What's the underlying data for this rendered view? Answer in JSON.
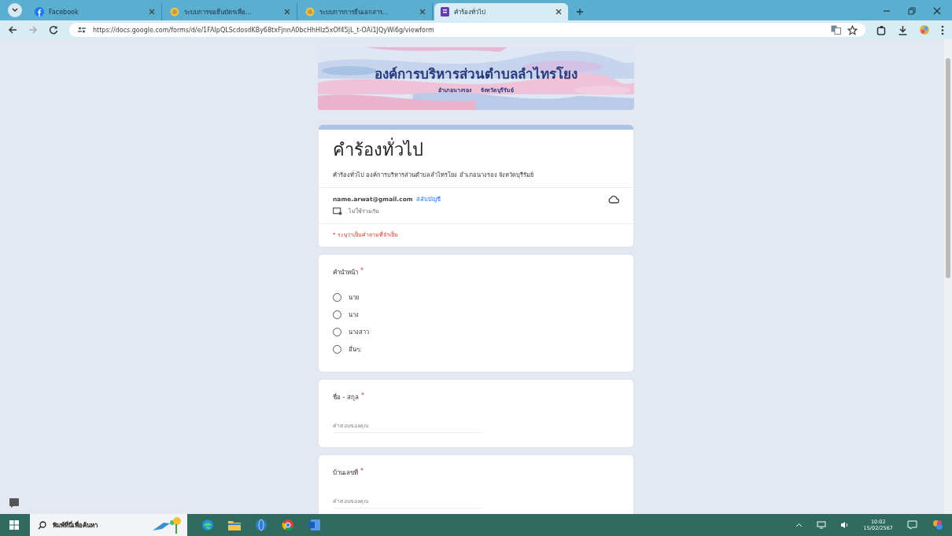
{
  "browser": {
    "tabs": [
      {
        "title": "Facebook",
        "selected": false
      },
      {
        "title": "ระบบการขอยื่นบัตรเพื่อ...",
        "selected": false
      },
      {
        "title": "ระบบการการยื่นเอกสาร...",
        "selected": false
      },
      {
        "title": "คำร้องทั่วไป",
        "selected": true
      }
    ],
    "url": "https://docs.google.com/forms/d/e/1FAIpQLScdosdKBy68txFjnnA0bcHhHIz5xOf45jL_t-OAi1JQyWi6g/viewform"
  },
  "form": {
    "banner": {
      "title": "องค์การบริหารส่วนตำบลลำไทรโยง",
      "subtitle": [
        "อำเภอนางรอง",
        "จังหวัดบุรีรัมย์"
      ]
    },
    "title": "คำร้องทั่วไป",
    "description": "คำร้องทั่วไป องค์การบริหารส่วนตำบลลำไทรโยง อำเภอนางรอง จังหวัดบุรีรัมย์",
    "account": {
      "email": "name.arwat@gmail.com",
      "switch_link": "สลับบัญชี"
    },
    "sharing_note": "ไม่ใช้ร่วมกัน",
    "required_note": "* ระบุว่าเป็นคำถามที่จำเป็น",
    "questions": [
      {
        "kind": "radio",
        "label": "คำนำหน้า",
        "required_mark": "*",
        "options": [
          {
            "label": "นาย",
            "selected": false
          },
          {
            "label": "นาง",
            "selected": false
          },
          {
            "label": "นางสาว",
            "selected": false
          },
          {
            "label": "อื่นๆ:",
            "selected": false
          }
        ]
      },
      {
        "kind": "text",
        "label": "ชื่อ - สกุล",
        "required_mark": "*",
        "placeholder": "คำตอบของคุณ"
      },
      {
        "kind": "text",
        "label": "บ้านเลขที่",
        "required_mark": "*",
        "placeholder": "คำตอบของคุณ"
      }
    ]
  },
  "taskbar": {
    "search_placeholder": "พิมพ์ที่นี่เพื่อค้นหา",
    "time": "10:02",
    "date": "15/02/2567"
  }
}
